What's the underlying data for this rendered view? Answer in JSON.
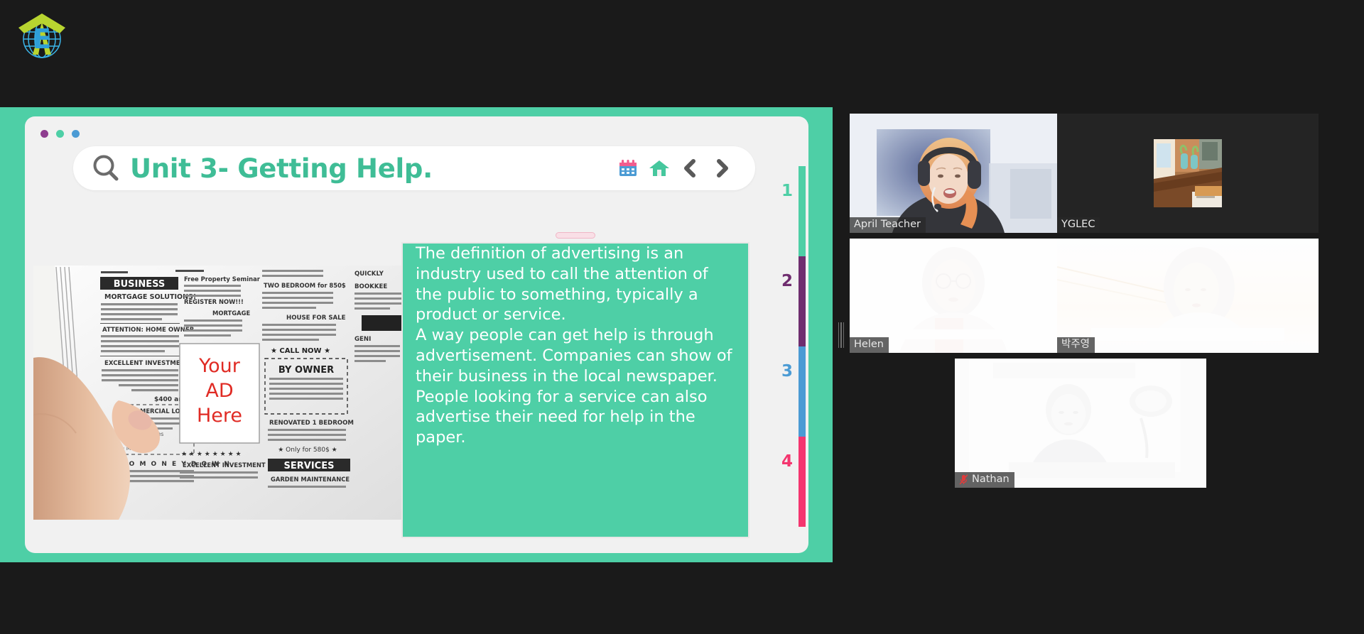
{
  "app": {
    "background_color": "#1a1a1a",
    "accent_color": "#4ecfa6"
  },
  "logo": {
    "name": "yglec-globe-arrow-logo",
    "letter": "E",
    "arrow_color": "#b8d430",
    "globe_color": "#3ab4e8",
    "letter_color": "#3ab4e8"
  },
  "slide": {
    "window_dots": [
      "#8e3d8f",
      "#4ecfa6",
      "#4b9bd4"
    ],
    "title": "Unit 3- Getting Help.",
    "title_color": "#3fbd96",
    "search_icon": "search-icon",
    "toolbar_icons": [
      {
        "name": "calendar-icon",
        "label": "Calendar"
      },
      {
        "name": "home-icon",
        "label": "Home"
      },
      {
        "name": "chevron-left-icon",
        "label": "Previous"
      },
      {
        "name": "chevron-right-icon",
        "label": "Next"
      }
    ],
    "page_rail": [
      {
        "number": "1",
        "color": "#4ecfa6"
      },
      {
        "number": "2",
        "color": "#6f2d6f"
      },
      {
        "number": "3",
        "color": "#4b9bd4"
      },
      {
        "number": "4",
        "color": "#f4366f"
      }
    ],
    "content_box": {
      "background": "#4ecfa6",
      "paragraph_1": " The definition of advertising is an industry used to call the attention of the public to something, typically a product or service.",
      "paragraph_2": "A way people can get help is through advertisement. Companies can show of their business in the local newspaper. People looking for a service can also advertise their need for help in the paper.",
      "drag_handle": "resize-handle"
    },
    "image": {
      "name": "newspaper-classifieds-photo",
      "alt": "A hand holding a newspaper classified-ads page",
      "headlines": [
        "BUSINESS",
        "MORTGAGE SOLUTIONS!",
        "ATTENTION: HOME OWNER",
        "EXCELLENT INVESTMENT",
        "COMMERCIAL LOANS",
        "NO MONEY DOWN",
        "TWO BEDROOM for 850$",
        "HOUSE FOR SALE",
        "CALL NOW",
        "BY OWNER",
        "RENOVATED 1 BEDROOM",
        "Only for 580$",
        "SERVICES",
        "GARDEN MAINTENANCE",
        "Free Property Seminar",
        "REGISTER NOW!!!",
        "BOOKKEEPING",
        "QUICKLY"
      ],
      "ad_placeholder": [
        "Your",
        "AD",
        "Here"
      ],
      "ad_placeholder_color": "#e02b24"
    }
  },
  "splitter": {
    "name": "panel-resize-handle"
  },
  "participants": [
    {
      "name": "April Teacher",
      "active_speaker": true,
      "muted": false,
      "video_on": true,
      "state": "speaking"
    },
    {
      "name": "YGLEC",
      "active_speaker": false,
      "muted": false,
      "video_on": false,
      "state": "avatar"
    },
    {
      "name": "Helen",
      "active_speaker": false,
      "muted": false,
      "video_on": true,
      "state": "overexposed"
    },
    {
      "name": "박주영",
      "active_speaker": false,
      "muted": false,
      "video_on": true,
      "state": "overexposed"
    },
    {
      "name": "Nathan",
      "active_speaker": false,
      "muted": true,
      "video_on": true,
      "state": "overexposed"
    }
  ]
}
